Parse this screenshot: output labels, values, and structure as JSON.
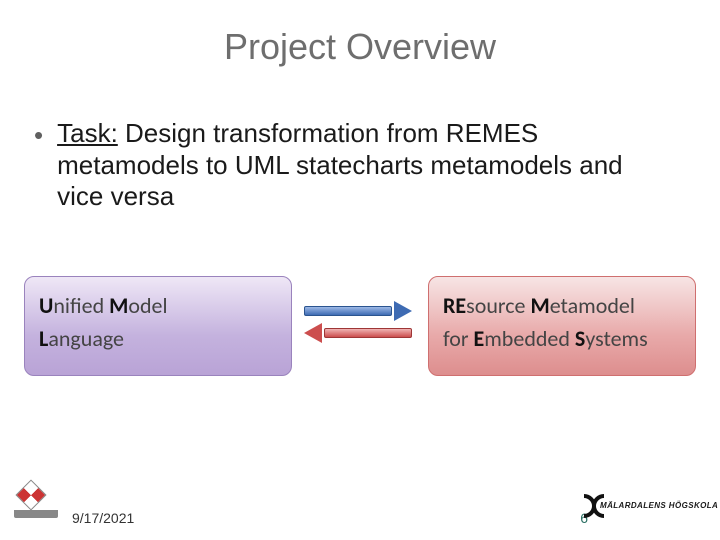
{
  "title": "Project Overview",
  "bullet": {
    "task_label": "Task:",
    "text_rest": " Design transformation from REMES metamodels to UML statecharts metamodels and vice versa"
  },
  "box_left": {
    "l1_u1": "U",
    "l1_r1": "nified ",
    "l1_u2": "M",
    "l1_r2": "odel",
    "l2_u1": "L",
    "l2_r1": "anguage"
  },
  "box_right": {
    "l1_u1": "RE",
    "l1_r1": "source ",
    "l1_u2": "M",
    "l1_r2": "etamodel",
    "l2_r0": "for ",
    "l2_u1": "E",
    "l2_r1": "mbedded ",
    "l2_u2": "S",
    "l2_r2": "ystems"
  },
  "footer": {
    "date": "9/17/2021",
    "page": "6",
    "right_logo_text": "MÄLARDALENS HÖGSKOLA"
  }
}
